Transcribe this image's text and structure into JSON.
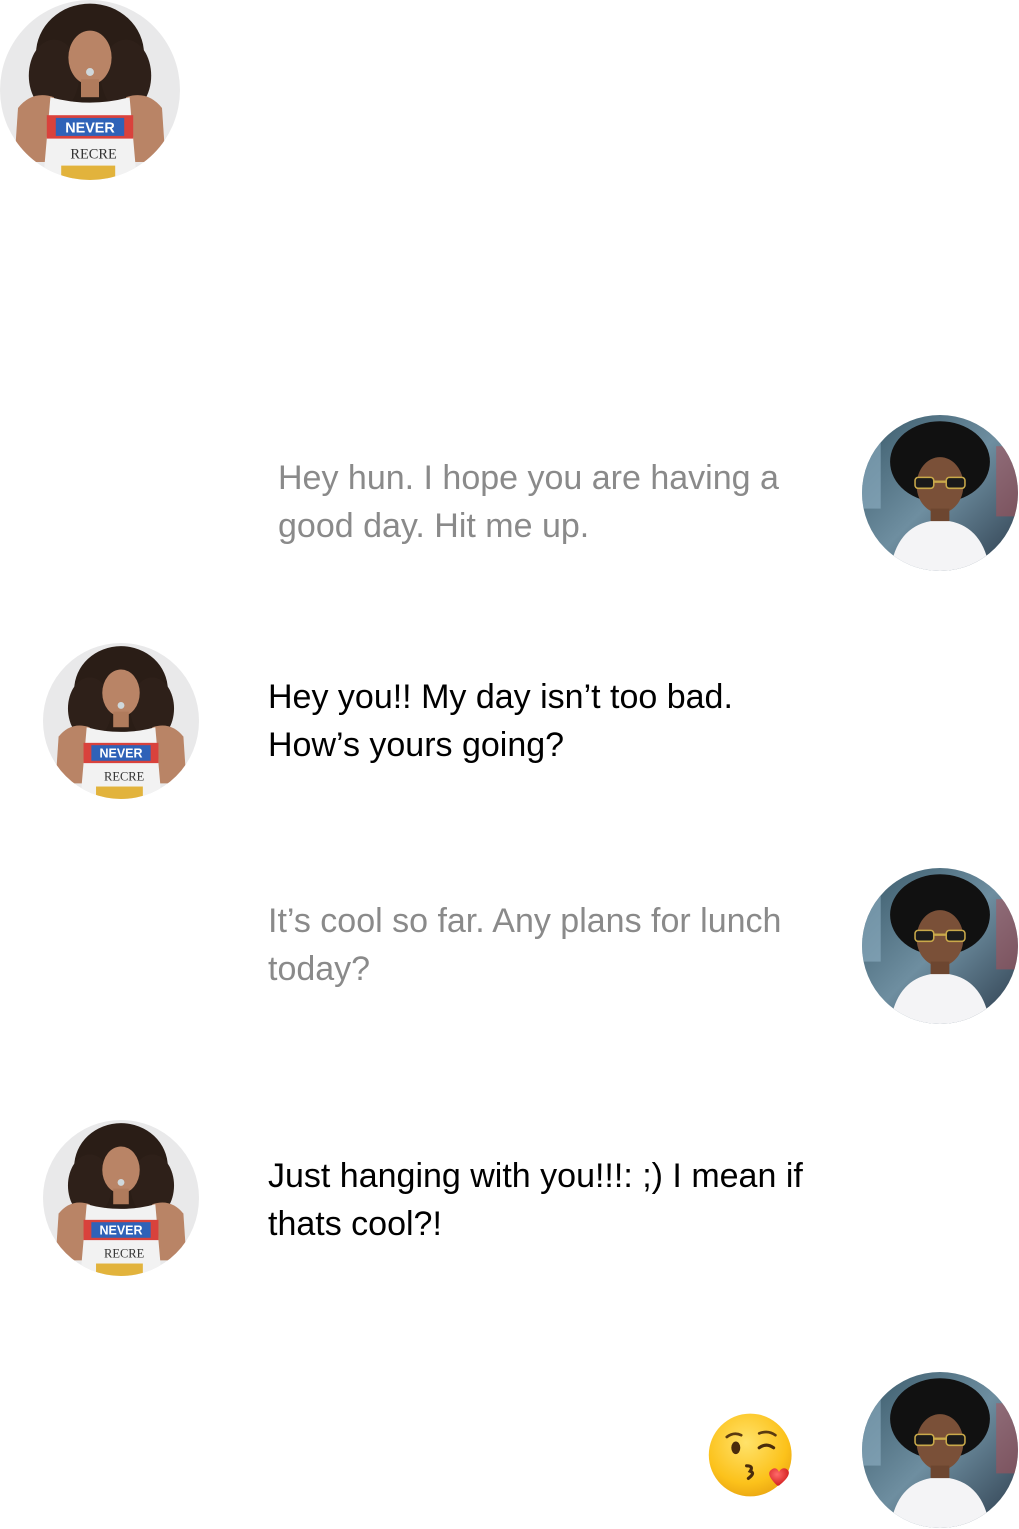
{
  "conversation": {
    "messages": [
      {
        "sender": "him",
        "text": "Hey hun. I hope you are having a good day. Hit me up."
      },
      {
        "sender": "her",
        "text": "Hey you!! My day isn’t too bad. How’s yours going?"
      },
      {
        "sender": "him",
        "text": "It’s cool so far. Any plans for lunch today?"
      },
      {
        "sender": "her",
        "text": "Just hanging with you!!!: ;) I mean if thats cool?!"
      },
      {
        "sender": "him",
        "emoji": "kissing-face-with-heart"
      }
    ]
  },
  "avatars": {
    "her": {
      "shirt_text": "NEVER",
      "shirt_text_2": "RECRE"
    }
  },
  "colors": {
    "incoming_text": "#8a8a8a",
    "outgoing_text": "#000000",
    "background": "#ffffff"
  }
}
